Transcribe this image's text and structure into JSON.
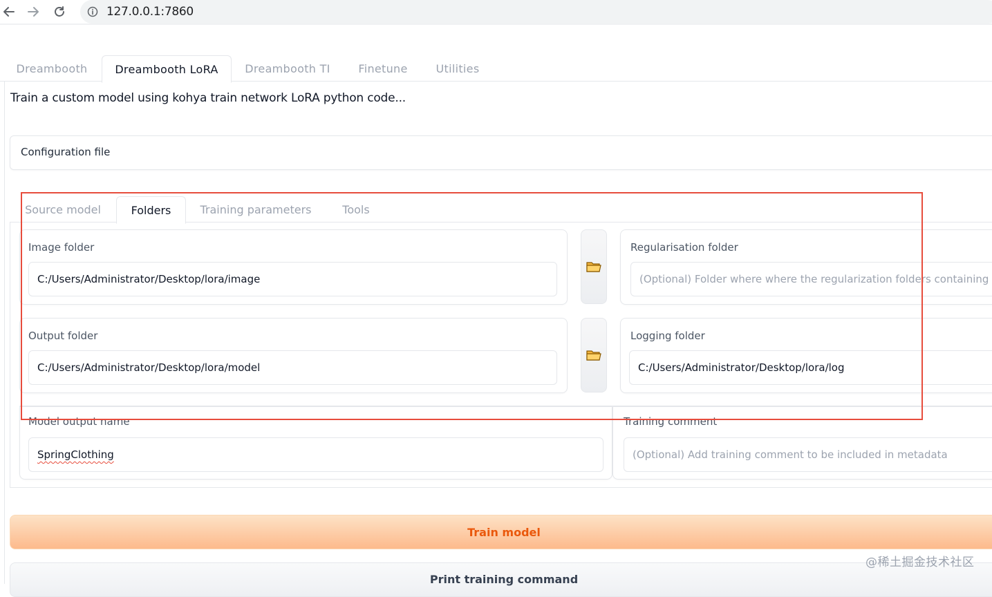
{
  "browser": {
    "url": "127.0.0.1:7860"
  },
  "top_tabs": [
    {
      "label": "Dreambooth",
      "active": false
    },
    {
      "label": "Dreambooth LoRA",
      "active": true
    },
    {
      "label": "Dreambooth TI",
      "active": false
    },
    {
      "label": "Finetune",
      "active": false
    },
    {
      "label": "Utilities",
      "active": false
    }
  ],
  "description": "Train a custom model using kohya train network LoRA python code...",
  "config": {
    "label": "Configuration file"
  },
  "inner_tabs": [
    {
      "label": "Source model",
      "active": false
    },
    {
      "label": "Folders",
      "active": true
    },
    {
      "label": "Training parameters",
      "active": false
    },
    {
      "label": "Tools",
      "active": false
    }
  ],
  "folders": {
    "image_folder": {
      "label": "Image folder",
      "value": "C:/Users/Administrator/Desktop/lora/image"
    },
    "regularisation_folder": {
      "label": "Regularisation folder",
      "placeholder": "(Optional) Folder where where the regularization folders containing the"
    },
    "output_folder": {
      "label": "Output folder",
      "value": "C:/Users/Administrator/Desktop/lora/model"
    },
    "logging_folder": {
      "label": "Logging folder",
      "value": "C:/Users/Administrator/Desktop/lora/log"
    },
    "model_output_name": {
      "label": "Model output name",
      "value": "SpringClothing"
    },
    "training_comment": {
      "label": "Training comment",
      "placeholder": "(Optional) Add training comment to be included in metadata"
    }
  },
  "buttons": {
    "train": "Train model",
    "print": "Print training command"
  },
  "watermark": "@稀土掘金技术社区",
  "colors": {
    "accent_orange": "#ea580c",
    "highlight_red": "#e74c3c"
  }
}
